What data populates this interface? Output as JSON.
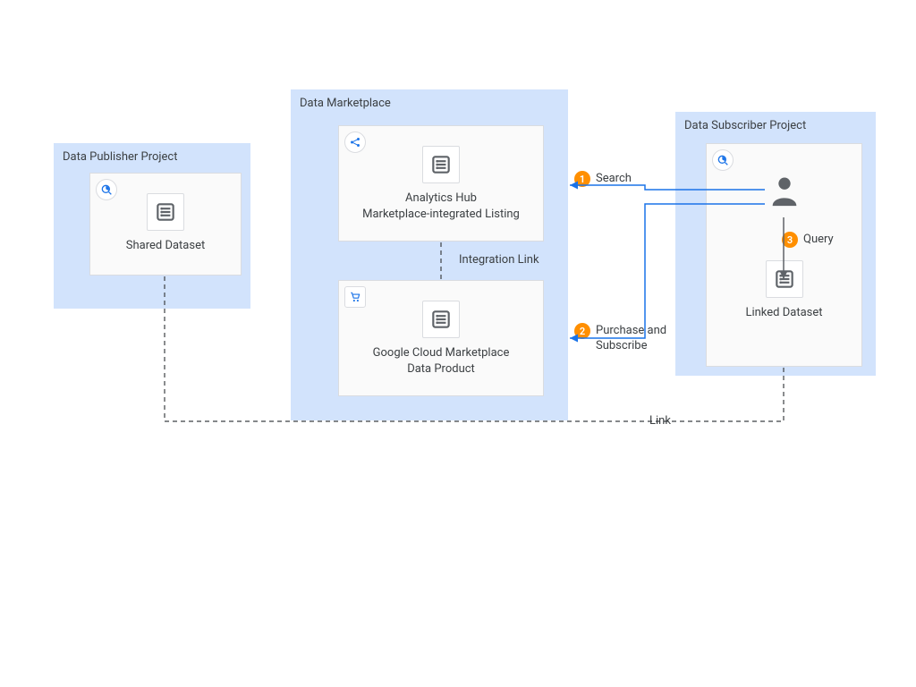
{
  "panels": {
    "publisher": {
      "title": "Data Publisher Project"
    },
    "marketplace": {
      "title": "Data Marketplace"
    },
    "subscriber": {
      "title": "Data Subscriber Project"
    }
  },
  "cards": {
    "shared_dataset": {
      "label": "Shared Dataset"
    },
    "analytics_hub": {
      "line1": "Analytics Hub",
      "line2": "Marketplace-integrated Listing"
    },
    "gcm_product": {
      "line1": "Google Cloud Marketplace",
      "line2": "Data Product"
    },
    "linked_dataset": {
      "label": "Linked Dataset"
    }
  },
  "steps": {
    "s1": {
      "num": "1",
      "label": "Search"
    },
    "s2": {
      "num": "2",
      "label": "Purchase and\nSubscribe"
    },
    "s3": {
      "num": "3",
      "label": "Query"
    }
  },
  "links": {
    "integration": "Integration Link",
    "bottom_link": "Link"
  }
}
